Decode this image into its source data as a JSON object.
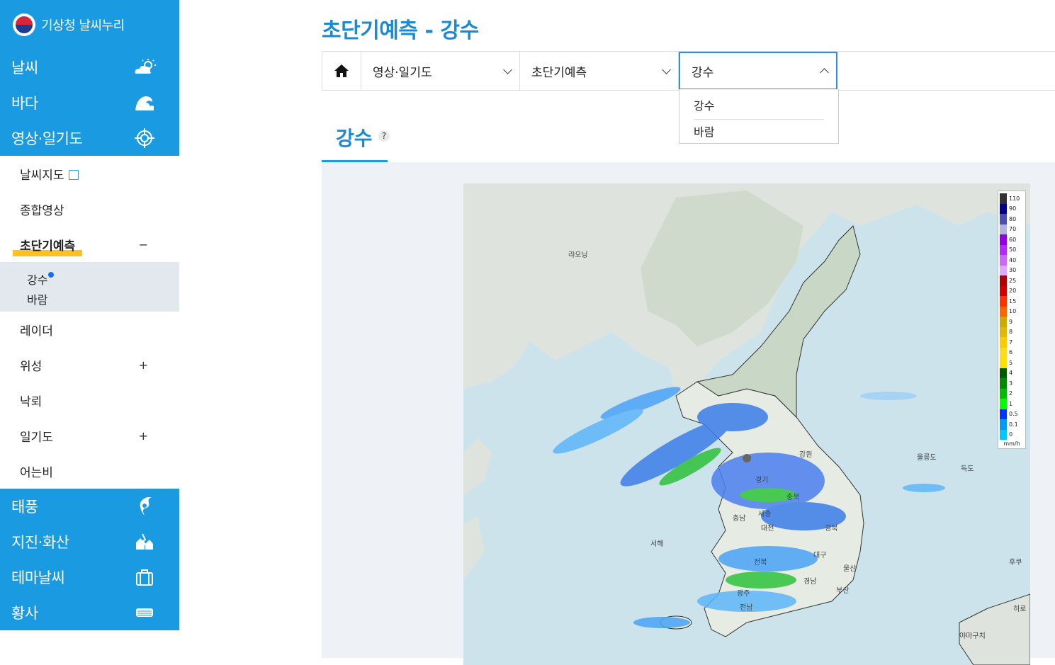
{
  "brand": {
    "title": "기상청 날씨누리"
  },
  "menu_top": [
    {
      "label": "날씨",
      "icon": "sun-cloud-icon"
    },
    {
      "label": "바다",
      "icon": "wave-icon"
    },
    {
      "label": "영상·일기도",
      "icon": "target-icon"
    }
  ],
  "submenu": {
    "items": [
      {
        "label": "날씨지도"
      },
      {
        "label": "종합영상"
      },
      {
        "label": "초단기예측",
        "toggle": "−"
      }
    ],
    "third": [
      "강수",
      "바람"
    ],
    "rest": [
      {
        "label": "레이더",
        "toggle": ""
      },
      {
        "label": "위성",
        "toggle": "+"
      },
      {
        "label": "낙뢰",
        "toggle": ""
      },
      {
        "label": "일기도",
        "toggle": "+"
      },
      {
        "label": "어는비",
        "toggle": ""
      }
    ]
  },
  "menu_bottom": [
    {
      "label": "태풍",
      "icon": "typhoon-icon"
    },
    {
      "label": "지진·화산",
      "icon": "earthquake-icon"
    },
    {
      "label": "테마날씨",
      "icon": "bag-icon"
    },
    {
      "label": "황사",
      "icon": "mask-icon"
    }
  ],
  "page_title": "초단기예측 - 강수",
  "breadcrumb": {
    "level1": "영상·일기도",
    "level2": "초단기예측",
    "level3": "강수"
  },
  "dropdown_options": [
    "강수",
    "바람"
  ],
  "tab": {
    "label": "강수",
    "help": "?"
  },
  "map_labels": {
    "liaoning": "랴오닝",
    "west_sea": "서해",
    "gangwon": "강원",
    "gyeonggi": "경기",
    "chungbuk": "충북",
    "chungnam": "충남",
    "sejong": "세종",
    "daejeon": "대전",
    "gyeongbuk": "경북",
    "daegu": "대구",
    "jeonbuk": "전북",
    "ulsan": "울산",
    "gyeongnam": "경남",
    "busan": "부산",
    "gwangju": "광주",
    "jeonnam": "전남",
    "ulleungdo": "울릉도",
    "dokdo": "독도",
    "hukuoka": "후쿠",
    "hiro": "히로",
    "yamaguchi": "야마구치"
  },
  "legend": {
    "unit": "mm/h",
    "levels": [
      {
        "v": "110",
        "c": "#333333"
      },
      {
        "v": "90",
        "c": "#000390"
      },
      {
        "v": "80",
        "c": "#4c4eb1"
      },
      {
        "v": "70",
        "c": "#b3b4de"
      },
      {
        "v": "60",
        "c": "#9300e4"
      },
      {
        "v": "50",
        "c": "#b329ff"
      },
      {
        "v": "40",
        "c": "#c969ff"
      },
      {
        "v": "30",
        "c": "#e0a9ff"
      },
      {
        "v": "25",
        "c": "#b40000"
      },
      {
        "v": "20",
        "c": "#d20000"
      },
      {
        "v": "15",
        "c": "#ff3200"
      },
      {
        "v": "10",
        "c": "#ff6600"
      },
      {
        "v": "9",
        "c": "#ccaa00"
      },
      {
        "v": "8",
        "c": "#e0b900"
      },
      {
        "v": "7",
        "c": "#f9cd00"
      },
      {
        "v": "6",
        "c": "#ffdc1f"
      },
      {
        "v": "5",
        "c": "#ffe100"
      },
      {
        "v": "4",
        "c": "#005a00"
      },
      {
        "v": "3",
        "c": "#008c00"
      },
      {
        "v": "2",
        "c": "#00be00"
      },
      {
        "v": "1",
        "c": "#00ff00"
      },
      {
        "v": "0.5",
        "c": "#0033ff"
      },
      {
        "v": "0.1",
        "c": "#009bf5"
      },
      {
        "v": "0",
        "c": "#00c8ff"
      }
    ]
  },
  "colors": {
    "primary": "#1a9ae0",
    "title": "#1a8ad4",
    "highlight": "#ffc21a"
  }
}
